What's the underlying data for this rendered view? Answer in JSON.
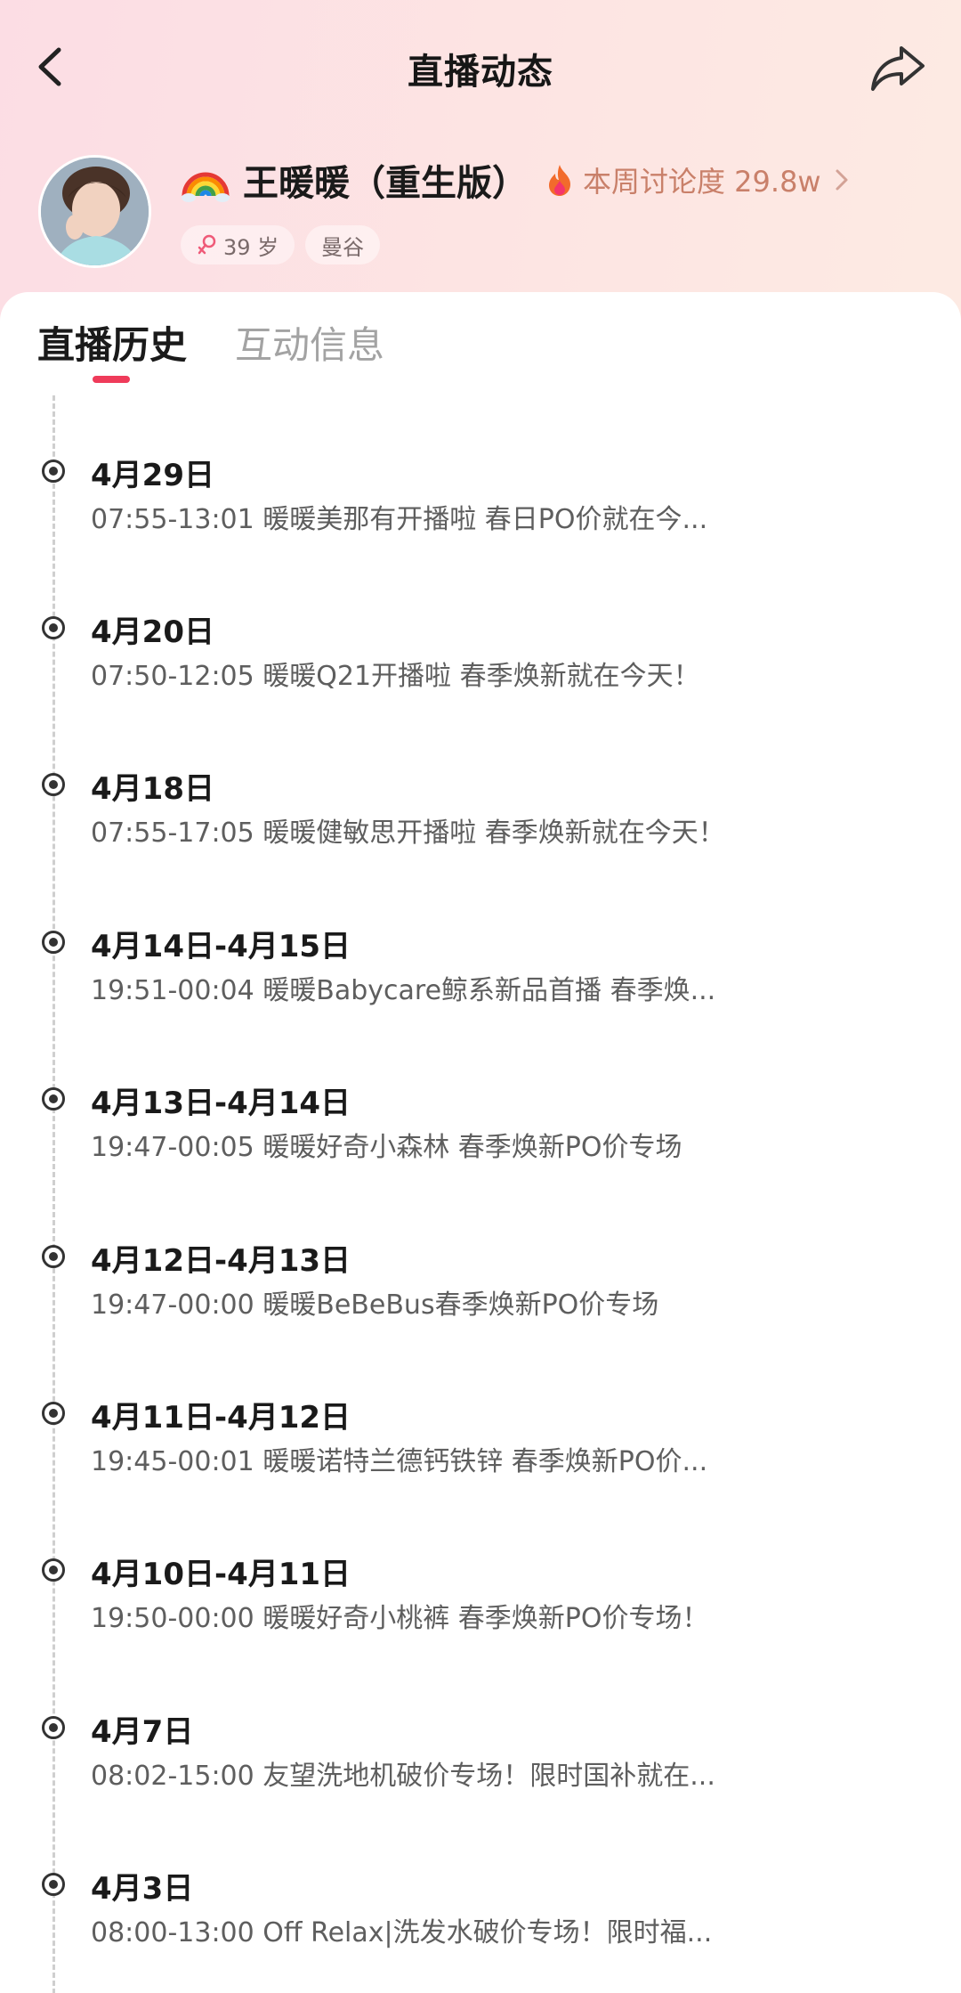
{
  "header": {
    "title": "直播动态",
    "back_icon": "chevron-left-icon",
    "share_icon": "share-arrow-icon"
  },
  "profile": {
    "name_icon": "rainbow-icon",
    "name": "王暖暖（重生版）",
    "heat_icon": "fire-icon",
    "heat_text": "本周讨论度 29.8w",
    "heat_chevron": "chevron-right-icon",
    "tags": [
      {
        "icon": "female-icon",
        "label": "39 岁"
      },
      {
        "label": "曼谷"
      }
    ]
  },
  "tabs": [
    {
      "label": "直播历史",
      "active": true
    },
    {
      "label": "互动信息",
      "active": false
    }
  ],
  "colors": {
    "accent": "#ef3b5a",
    "heat": "#c9806a",
    "text_primary": "#1a1a1a",
    "text_secondary": "#5e5e5e"
  },
  "history": [
    {
      "date": "4月29日",
      "desc": "07:55-13:01 暖暖美那有开播啦  春日PO价就在今..."
    },
    {
      "date": "4月20日",
      "desc": "07:50-12:05 暖暖Q21开播啦  春季焕新就在今天！"
    },
    {
      "date": "4月18日",
      "desc": "07:55-17:05 暖暖健敏思开播啦  春季焕新就在今天！"
    },
    {
      "date": "4月14日-4月15日",
      "desc": "19:51-00:04 暖暖Babycare鲸系新品首播 春季焕..."
    },
    {
      "date": "4月13日-4月14日",
      "desc": "19:47-00:05 暖暖好奇小森林  春季焕新PO价专场"
    },
    {
      "date": "4月12日-4月13日",
      "desc": "19:47-00:00 暖暖BeBeBus春季焕新PO价专场"
    },
    {
      "date": "4月11日-4月12日",
      "desc": "19:45-00:01 暖暖诺特兰德钙铁锌  春季焕新PO价..."
    },
    {
      "date": "4月10日-4月11日",
      "desc": "19:50-00:00 暖暖好奇小桃裤  春季焕新PO价专场！"
    },
    {
      "date": "4月7日",
      "desc": "08:02-15:00 友望洗地机破价专场！限时国补就在..."
    },
    {
      "date": "4月3日",
      "desc": "08:00-13:00 Off  Relax|洗发水破价专场！限时福..."
    }
  ]
}
